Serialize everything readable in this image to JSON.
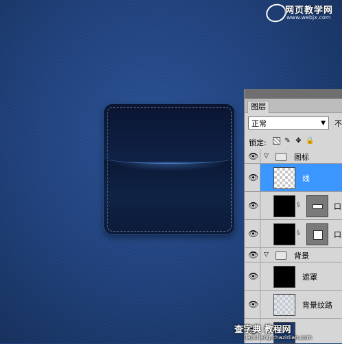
{
  "watermark": {
    "title": "网页教学网",
    "url": "www.webjx.com"
  },
  "panel": {
    "tab_label": "图层",
    "blend_mode": "正常",
    "opacity_label": "不",
    "lock_label": "锁定:",
    "layers": [
      {
        "type": "group",
        "name": "图标",
        "expanded": true,
        "visible": true
      },
      {
        "type": "layer",
        "name": "线",
        "thumb": "transparent",
        "selected": true,
        "visible": true
      },
      {
        "type": "layer",
        "name": "口",
        "thumb": "black",
        "mask": "mask-small",
        "visible": true
      },
      {
        "type": "layer",
        "name": "口",
        "thumb": "black",
        "mask": "mask-large",
        "visible": true
      },
      {
        "type": "group",
        "name": "背景",
        "expanded": true,
        "visible": true
      },
      {
        "type": "layer",
        "name": "遮罩",
        "thumb": "black",
        "visible": true
      },
      {
        "type": "layer",
        "name": "背景纹路",
        "thumb": "transparent",
        "visible": true
      }
    ]
  },
  "bottom_watermark": {
    "title": "查字典 教程网",
    "url": "jiaocheng.chazidian.com"
  },
  "colors": {
    "selection": "#3c96ff",
    "panel_bg": "#d6d6d6",
    "denim": "#1f4280"
  }
}
